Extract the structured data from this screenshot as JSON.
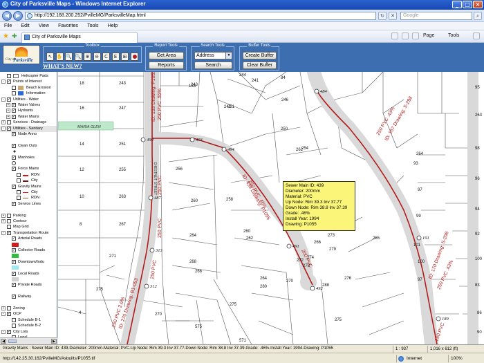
{
  "window": {
    "title": "City of Parksville Maps - Windows Internet Explorer"
  },
  "address": {
    "url": "http://192.168.200.252/PvilleMG/ParksvilleMap.html",
    "search_placeholder": "Google"
  },
  "menu": [
    "File",
    "Edit",
    "View",
    "Favorites",
    "Tools",
    "Help"
  ],
  "tab": {
    "label": "City of Parksville Maps"
  },
  "commands": {
    "page": "Page",
    "tools": "Tools"
  },
  "app": {
    "logo_small": "City of",
    "logo_name": "Parksville",
    "whats_new": "WHAT'S NEW?",
    "toolbox_title": "Toolbox",
    "toolbox_icons": [
      "pointer-icon",
      "pan-icon",
      "zoom-in-icon",
      "zoom-out-icon",
      "zoom-window-icon",
      "magnify-icon",
      "full-extent-icon",
      "measure-icon",
      "identify-icon",
      "record-icon"
    ],
    "toolbox_glyphs": [
      "↖",
      "✋",
      "🔍",
      "🔍",
      "⊕",
      "⊖",
      "C",
      "E",
      "⊞",
      ""
    ],
    "report_title": "Report Tools",
    "get_area": "Get Area",
    "reports": "Reports",
    "search_title": "Search Tools",
    "search_select": "Address",
    "search_btn": "Search",
    "buffer_title": "Buffer Tools",
    "create_buffer": "Create Buffer",
    "clear_buffer": "Clear Buffer"
  },
  "layers": [
    {
      "label": "Helicopter Pads",
      "checked": false,
      "indent": 0,
      "icon": "helipad",
      "toggle": ""
    },
    {
      "label": "Points of Interest",
      "checked": true,
      "indent": 0,
      "icon": "",
      "toggle": "-"
    },
    {
      "label": "Beach Erosion",
      "checked": false,
      "indent": 1,
      "icon": "erosion",
      "toggle": ""
    },
    {
      "label": "Information",
      "checked": false,
      "indent": 1,
      "icon": "info",
      "toggle": ""
    },
    {
      "label": "Utilities - Water",
      "checked": true,
      "indent": 0,
      "icon": "",
      "toggle": "-"
    },
    {
      "label": "Water Valves",
      "checked": true,
      "indent": 1,
      "icon": "",
      "toggle": "+"
    },
    {
      "label": "Hydrants",
      "checked": true,
      "indent": 1,
      "icon": "",
      "toggle": "+"
    },
    {
      "label": "Water Mains",
      "checked": true,
      "indent": 1,
      "icon": "",
      "toggle": "+"
    },
    {
      "label": "Services - Drainage",
      "checked": false,
      "indent": 0,
      "icon": "",
      "toggle": "+"
    },
    {
      "label": "Utilities - Sanitary",
      "checked": true,
      "indent": 0,
      "icon": "",
      "toggle": "-",
      "highlight": true
    },
    {
      "label": "Node Anno",
      "checked": true,
      "indent": 1,
      "icon": "",
      "toggle": ""
    },
    {
      "label": "",
      "checked": false,
      "indent": 1,
      "icon": "",
      "toggle": ""
    },
    {
      "label": "Clean Outs",
      "checked": true,
      "indent": 1,
      "icon": "",
      "toggle": ""
    },
    {
      "label": "",
      "checked": false,
      "indent": 1,
      "icon": "dot",
      "toggle": ""
    },
    {
      "label": "Manholes",
      "checked": true,
      "indent": 1,
      "icon": "",
      "toggle": ""
    },
    {
      "label": "",
      "checked": false,
      "indent": 1,
      "icon": "circle",
      "toggle": ""
    },
    {
      "label": "Force Mains",
      "checked": true,
      "indent": 1,
      "icon": "",
      "toggle": ""
    },
    {
      "label": "RDN",
      "checked": false,
      "indent": 2,
      "icon": "line-red",
      "toggle": ""
    },
    {
      "label": "City",
      "checked": false,
      "indent": 2,
      "icon": "line-darkred",
      "toggle": ""
    },
    {
      "label": "Gravity Mains",
      "checked": true,
      "indent": 1,
      "icon": "",
      "toggle": ""
    },
    {
      "label": "City",
      "checked": false,
      "indent": 2,
      "icon": "line-thin-red",
      "toggle": ""
    },
    {
      "label": "RDN",
      "checked": false,
      "indent": 2,
      "icon": "line-thin-brown",
      "toggle": ""
    },
    {
      "label": "Service Lines",
      "checked": true,
      "indent": 1,
      "icon": "",
      "toggle": ""
    },
    {
      "label": "",
      "checked": false,
      "indent": 1,
      "icon": "",
      "toggle": ""
    },
    {
      "label": "Parking",
      "checked": false,
      "indent": 0,
      "icon": "",
      "toggle": "+"
    },
    {
      "label": "Contour",
      "checked": false,
      "indent": 0,
      "icon": "",
      "toggle": "+"
    },
    {
      "label": "Map Grid",
      "checked": false,
      "indent": 0,
      "icon": "",
      "toggle": ""
    },
    {
      "label": "Transportation Route",
      "checked": true,
      "indent": 0,
      "icon": "",
      "toggle": "-"
    },
    {
      "label": "Arterial Roads",
      "checked": true,
      "indent": 1,
      "icon": "",
      "toggle": ""
    },
    {
      "label": "",
      "checked": false,
      "indent": 1,
      "icon": "swatch-red",
      "toggle": ""
    },
    {
      "label": "Collector Roads",
      "checked": true,
      "indent": 1,
      "icon": "",
      "toggle": ""
    },
    {
      "label": "",
      "checked": false,
      "indent": 1,
      "icon": "swatch-green",
      "toggle": ""
    },
    {
      "label": "Downtown/Indu",
      "checked": true,
      "indent": 1,
      "icon": "",
      "toggle": ""
    },
    {
      "label": "",
      "checked": false,
      "indent": 1,
      "icon": "swatch-cyan",
      "toggle": ""
    },
    {
      "label": "Local Roads",
      "checked": true,
      "indent": 1,
      "icon": "",
      "toggle": ""
    },
    {
      "label": "",
      "checked": false,
      "indent": 1,
      "icon": "swatch-grey",
      "toggle": ""
    },
    {
      "label": "Private Roads",
      "checked": true,
      "indent": 1,
      "icon": "",
      "toggle": ""
    },
    {
      "label": "",
      "checked": false,
      "indent": 1,
      "icon": "",
      "toggle": ""
    },
    {
      "label": "Railway",
      "checked": true,
      "indent": 1,
      "icon": "",
      "toggle": ""
    },
    {
      "label": "",
      "checked": false,
      "indent": 1,
      "icon": "",
      "toggle": ""
    },
    {
      "label": "Zoning",
      "checked": false,
      "indent": 0,
      "icon": "",
      "toggle": "+"
    },
    {
      "label": "OCP",
      "checked": true,
      "indent": 0,
      "icon": "",
      "toggle": "-"
    },
    {
      "label": "Schedule B-1",
      "checked": false,
      "indent": 1,
      "icon": "",
      "toggle": ""
    },
    {
      "label": "Schedule B-2",
      "checked": false,
      "indent": 1,
      "icon": "",
      "toggle": ""
    },
    {
      "label": "City Lots",
      "checked": true,
      "indent": 0,
      "icon": "",
      "toggle": "-"
    },
    {
      "label": "Legal",
      "checked": false,
      "indent": 1,
      "icon": "",
      "toggle": ""
    }
  ],
  "map": {
    "lots": [
      "18",
      "243",
      "16",
      "247",
      "14",
      "251",
      "12",
      "255",
      "10",
      "263",
      "8",
      "267",
      "271",
      "275",
      "4",
      "133",
      "243",
      "244",
      "241",
      "84",
      "242",
      "251",
      "246",
      "250",
      "254",
      "256",
      "262",
      "258",
      "260",
      "259",
      "264",
      "260",
      "262",
      "264",
      "268",
      "266",
      "270",
      "275",
      "575",
      "280",
      "270",
      "272",
      "273",
      "274",
      "278",
      "279",
      "288",
      "275",
      "276",
      "571",
      "266",
      "265",
      "264",
      "93",
      "97",
      "99",
      "101",
      "100",
      "97",
      "95",
      "263",
      "98",
      "96",
      "94",
      "92",
      "100",
      "83",
      "86",
      "90",
      "73"
    ],
    "manholes": [
      "490",
      "493",
      "494",
      "484",
      "487",
      "313",
      "312",
      "491",
      "492",
      "191",
      "189"
    ],
    "pipes": [
      "250 PVC .55%",
      "ID: 133 Drawing: P1053",
      "250 PVC",
      "250 PVC",
      "250 PVC",
      "250 PVC 2.6%",
      "ID: 270 Drawing: B1-053",
      "250 PVC .46%",
      "ID: 439 Drawing: P1055",
      "200 PVC",
      "250 PVC .43%",
      "ID: 167 Drawing: S-298",
      "250 PVC .43%",
      "ID: 170 Drawing: S-298",
      "250 PVC"
    ],
    "street": "CHESTNUT STREET",
    "green_label": "MARIA GLEN"
  },
  "tooltip": {
    "line1": "Sewer Main ID:  439",
    "line2": "Diameter:  200mm",
    "line3": "Material:  PVC",
    "line4": "Up Node:       Rim  39.3   Inv  37.77",
    "line5": "Down Node:   Rim  38.8   Inv  37.39",
    "line6": "Grade:  .46%",
    "line7": "Install Year:  1994",
    "line8": "Drawing:  P1055"
  },
  "map_status": {
    "info": "Gravity Mains : Sewer Main ID:  439-Diameter:  200mm-Material:  PVC-Up Node:      Rim  39.3   Inv  37.77-Down Node:   Rim  38.8   Inv  37.39-Grade:  .46%-Install Year:  1994-Drawing:  P1055",
    "scale": "1 : 937",
    "size": "1,016 x 612 (ft)"
  },
  "ie_status": {
    "text": "http://142.25.30.162/PvilleMG/Asbuilts/P1055.tif",
    "zone": "Internet",
    "zoom": "100%"
  },
  "colors": {
    "pipe": "#b31b1b",
    "header": "#3d6fb0",
    "tooltip": "#fbf67a",
    "road_fill": "#d9d9d9"
  }
}
